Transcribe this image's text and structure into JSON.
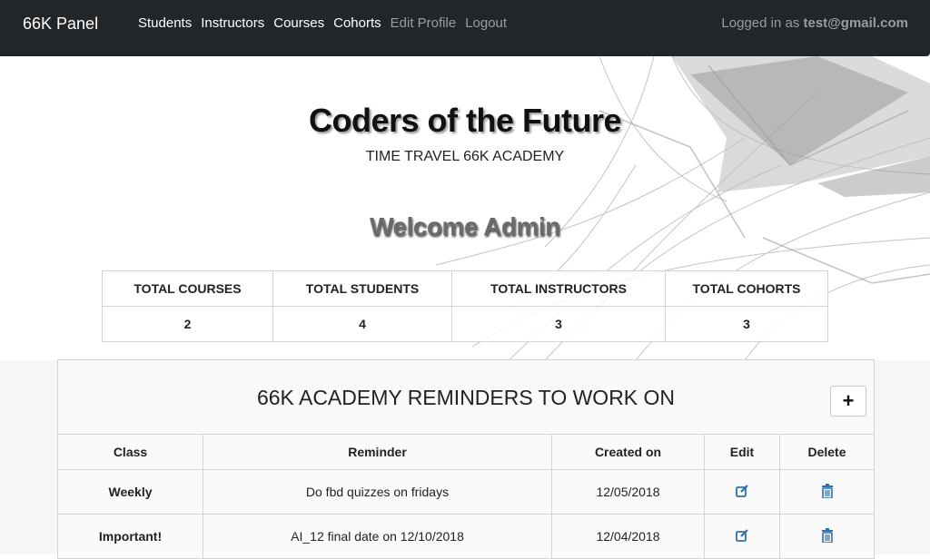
{
  "nav": {
    "brand": "66K Panel",
    "links": [
      "Students",
      "Instructors",
      "Courses",
      "Cohorts",
      "Edit Profile",
      "Logout"
    ],
    "logged_prefix": "Logged in as",
    "user_email": "test@gmail.com"
  },
  "hero": {
    "title": "Coders of the Future",
    "subtitle": "TIME TRAVEL 66K ACADEMY",
    "welcome": "Welcome Admin"
  },
  "stats": {
    "headers": [
      "TOTAL COURSES",
      "TOTAL STUDENTS",
      "TOTAL INSTRUCTORS",
      "TOTAL COHORTS"
    ],
    "values": [
      "2",
      "4",
      "3",
      "3"
    ]
  },
  "reminders": {
    "title": "66K ACADEMY REMINDERS TO WORK ON",
    "add_label": "+",
    "headers": [
      "Class",
      "Reminder",
      "Created on",
      "Edit",
      "Delete"
    ],
    "rows": [
      {
        "class": "Weekly",
        "reminder": "Do fbd quizzes on fridays",
        "created": "12/05/2018"
      },
      {
        "class": "Important!",
        "reminder": "AI_12 final date on 12/10/2018",
        "created": "12/04/2018"
      }
    ]
  },
  "colors": {
    "navbar": "#232629",
    "icon_blue": "#2f6fb0"
  },
  "icons": {
    "edit": "edit-icon",
    "delete": "trash-icon"
  }
}
